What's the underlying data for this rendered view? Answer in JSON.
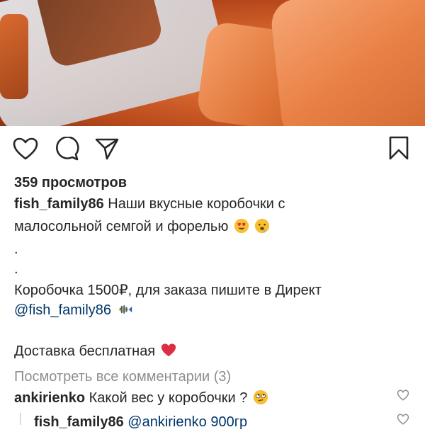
{
  "post": {
    "views": "359 просмотров",
    "username": "fish_family86",
    "caption_line1": "Наши вкусные коробочки с",
    "caption_line2": "малосольной семгой и форелью",
    "dot1": ".",
    "dot2": ".",
    "price_line": "Коробочка 1500₽, для заказа пишите в Директ",
    "mention": "@fish_family86",
    "delivery": "Доставка бесплатная",
    "view_all_comments": "Посмотреть все комментарии (3)"
  },
  "comments": [
    {
      "user": "ankirienko",
      "text": "Какой вес у коробочки ?"
    },
    {
      "user": "fish_family86",
      "text": "@ankirienko 900гр"
    }
  ],
  "icons": {
    "like": "heart-outline-icon",
    "comment": "comment-bubble-icon",
    "share": "paper-plane-icon",
    "save": "bookmark-icon"
  }
}
